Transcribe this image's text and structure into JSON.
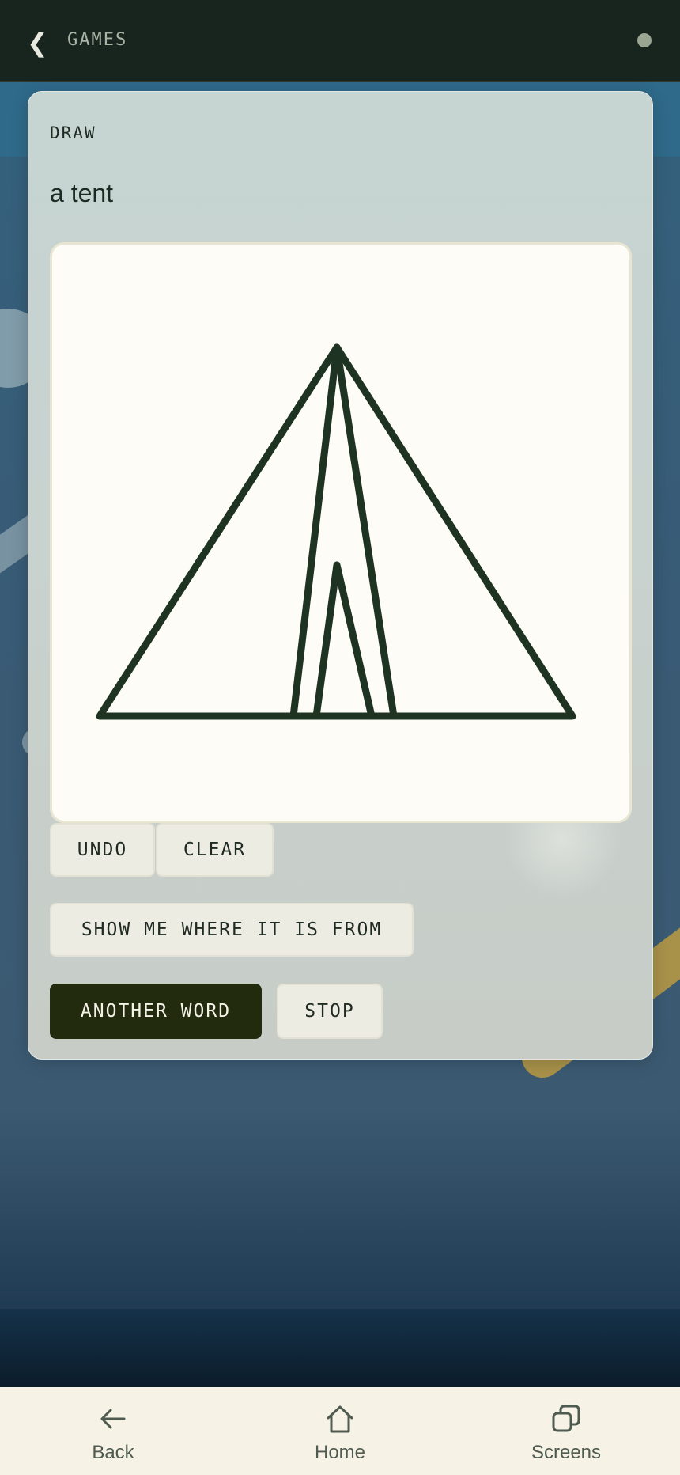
{
  "topbar": {
    "back_glyph": "❮",
    "title": "GAMES"
  },
  "card": {
    "label": "DRAW",
    "prompt_word": "a tent"
  },
  "actions": {
    "undo": "UNDO",
    "clear": "CLEAR",
    "show_origin": "SHOW ME WHERE IT IS FROM",
    "another_word": "ANOTHER WORD",
    "stop": "STOP"
  },
  "navbar": {
    "items": [
      {
        "label": "Back",
        "icon": "arrow-left-icon"
      },
      {
        "label": "Home",
        "icon": "home-icon"
      },
      {
        "label": "Screens",
        "icon": "screens-icon"
      }
    ]
  },
  "colors": {
    "topbar": "#18251e",
    "card": "#c8d2cf",
    "canvas": "#fdfcf7",
    "stroke": "#1f3322",
    "primary_button": "#222b0e",
    "navbar": "#f6f3e6",
    "accent_gold": "#a8924a"
  }
}
